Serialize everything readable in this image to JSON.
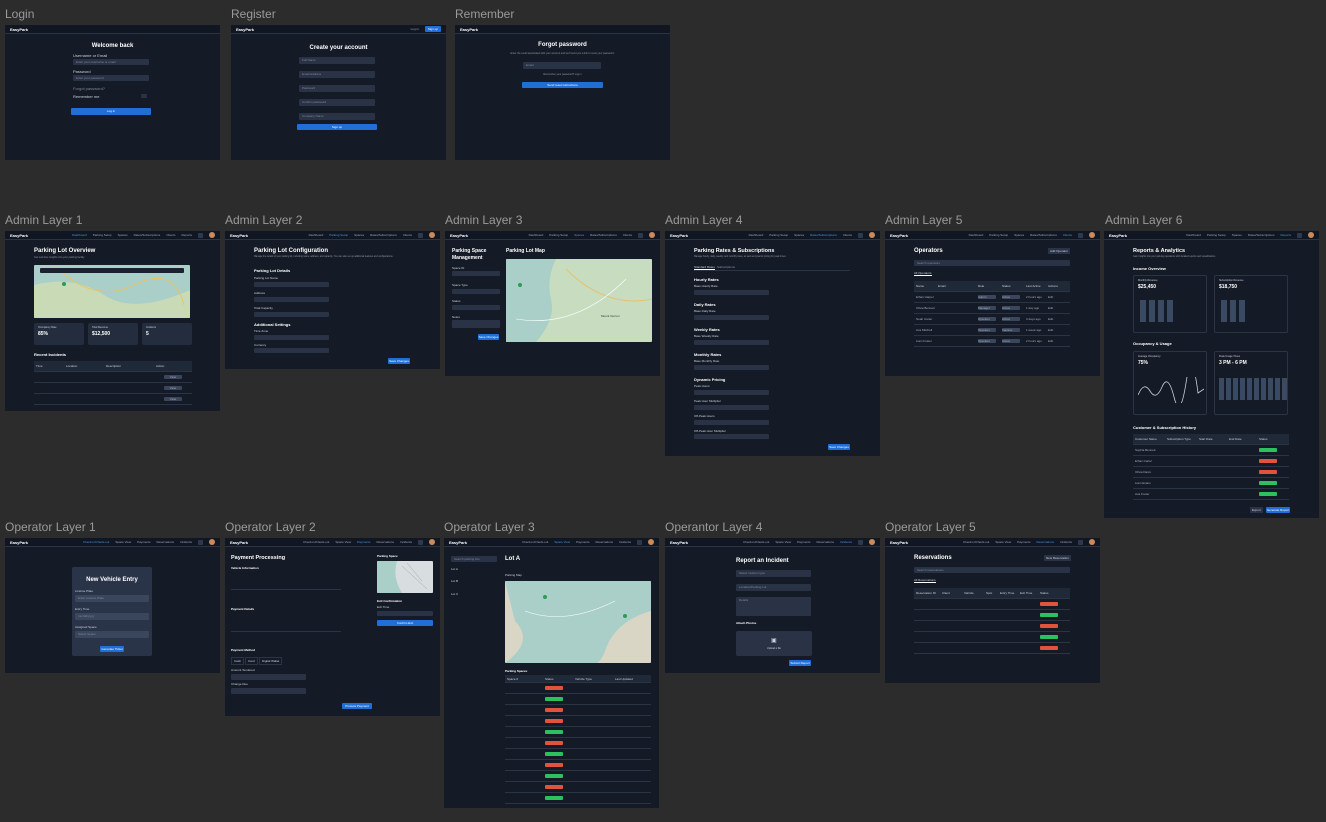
{
  "brand": "EasyPark",
  "labels": {
    "login": "Login",
    "register": "Register",
    "remember": "Remember",
    "admin1": "Admin Layer 1",
    "admin2": "Admin Layer 2",
    "admin3": "Admin Layer 3",
    "admin4": "Admin Layer 4",
    "admin5": "Admin Layer 5",
    "admin6": "Admin Layer 6",
    "op1": "Operator Layer 1",
    "op2": "Operator Layer 2",
    "op3": "Operator Layer 3",
    "op4": "Operantor Layer 4",
    "op5": "Operator Layer 5"
  },
  "login": {
    "title": "Welcome back",
    "user_label": "Username or Email",
    "user_ph": "Enter your username or email",
    "pass_label": "Password",
    "pass_ph": "Enter your password",
    "forgot": "Forgot password?",
    "remember": "Remember me",
    "button": "Log in"
  },
  "register": {
    "nav_login": "Log in",
    "nav_signup": "Sign up",
    "title": "Create your account",
    "fields": [
      "Full Name",
      "Email Address",
      "Password",
      "Confirm password",
      "Company Name"
    ],
    "button": "Sign up"
  },
  "remember": {
    "title": "Forgot password",
    "subtitle": "Enter the email associated with your account and we'll send you a link to reset your password.",
    "email_ph": "Email",
    "remembered": "Remember your password? Log in",
    "button": "Send reset instructions"
  },
  "admin_nav": [
    "Dashboard",
    "Parking Setup",
    "Spaces",
    "Rates/Subscriptions",
    "Clients",
    "Reports"
  ],
  "admin1": {
    "title": "Parking Lot Overview",
    "subtitle": "Get real-time insights into your parking facility",
    "stats": [
      {
        "label": "Occupancy Rate",
        "value": "85%"
      },
      {
        "label": "Total Revenue",
        "value": "$12,500"
      },
      {
        "label": "Incidents",
        "value": "5"
      }
    ],
    "incidents_title": "Recent Incidents",
    "cols": [
      "Time",
      "Location",
      "Description",
      "Action"
    ],
    "action": "View"
  },
  "admin2": {
    "title": "Parking Lot Configuration",
    "subtitle": "Manage the details of your parking lot, including name, address, and capacity. You can also set up additional features and configurations.",
    "section1": "Parking Lot Details",
    "f1": "Parking Lot Name",
    "f2": "Address",
    "f3": "Total Capacity",
    "section2": "Additional Settings",
    "f4": "Time Zone",
    "f5": "Currency",
    "button": "Save Changes"
  },
  "admin3": {
    "title1": "Parking Space",
    "title2": "Management",
    "map_title": "Parking Lot Map",
    "f1": "Space ID",
    "f2": "Space Type",
    "f3": "Status",
    "f4": "Notes",
    "button": "Save Changes",
    "map_city": "Mount Vernon"
  },
  "admin4": {
    "title": "Parking Rates & Subscriptions",
    "subtitle": "Manage hourly, daily, weekly, and monthly rates, as well as dynamic pricing for peak times.",
    "tabs": [
      "Standard Rates",
      "Subscriptions"
    ],
    "sections": [
      {
        "h": "Hourly Rates",
        "f": "Base Hourly Rate"
      },
      {
        "h": "Daily Rates",
        "f": "Base Daily Rate"
      },
      {
        "h": "Weekly Rates",
        "f": "Base Weekly Rate"
      },
      {
        "h": "Monthly Rates",
        "f": "Base Monthly Rate"
      },
      {
        "h": "Dynamic Pricing",
        "f": "Peak Hours"
      }
    ],
    "extra": [
      "Peak Hour Multiplier",
      "Off-Peak Hours",
      "Off-Peak Hour Multiplier"
    ],
    "button": "Save Changes"
  },
  "admin5": {
    "title": "Operators",
    "add": "Add Operator",
    "search_ph": "Search operators",
    "tab": "All Operators",
    "cols": [
      "Name",
      "Email",
      "Role",
      "Status",
      "Last Active",
      "Actions"
    ],
    "rows": [
      {
        "name": "Ethan Harper",
        "role": "Admin",
        "status": "Active",
        "last": "2 hours ago"
      },
      {
        "name": "Olivia Bennett",
        "role": "Manager",
        "status": "Active",
        "last": "1 day ago"
      },
      {
        "name": "Noah Carter",
        "role": "Operator",
        "status": "Active",
        "last": "3 days ago"
      },
      {
        "name": "Ava Mitchell",
        "role": "Operator",
        "status": "Inactive",
        "last": "1 week ago"
      },
      {
        "name": "Liam Foster",
        "role": "Operator",
        "status": "Active",
        "last": "2 hours ago"
      }
    ],
    "action": "Edit"
  },
  "admin6": {
    "title": "Reports & Analytics",
    "subtitle": "Gain insights into your parking operations with detailed reports and visualizations.",
    "income": "Income Overview",
    "c1_label": "Monthly Revenue",
    "c1_value": "$25,450",
    "c2_label": "Subscription Revenue",
    "c2_value": "$18,750",
    "occ": "Occupancy & Usage",
    "c3_label": "Average Occupancy",
    "c3_value": "75%",
    "c4_label": "Peak Usage Times",
    "c4_value": "3 PM - 6 PM",
    "history": "Customer & Subscription History",
    "hist_cols": [
      "Customer Name",
      "Subscription Type",
      "Start Date",
      "End Date",
      "Status"
    ],
    "hist_rows": [
      "Sophia Bennett",
      "Ethan Carter",
      "Olivia Davis",
      "Liam Evans",
      "Ava Foster"
    ],
    "export": "Export",
    "generate": "Generate Report"
  },
  "op_nav": [
    "Check-in/Check-out",
    "Space View",
    "Payments",
    "Reservations",
    "Incidents"
  ],
  "op1": {
    "title": "New Vehicle Entry",
    "f1": "License Plate",
    "f1_ph": "Enter License Plate",
    "f2": "Entry Time",
    "f2_ph": "mm/dd/yyyy",
    "f3": "Assigned Space",
    "f3_ph": "Select Space",
    "button": "Generate Ticket"
  },
  "op2": {
    "title": "Payment Processing",
    "vinfo": "Vehicle Information",
    "pdetails": "Payment Details",
    "pmethod": "Payment Method",
    "methods": [
      "Cash",
      "Card",
      "Digital Wallet"
    ],
    "amount": "Amount Tendered",
    "change": "Change Due",
    "space": "Parking Space",
    "exit": "Exit Confirmation",
    "exit_time": "Exit Time",
    "confirm": "Confirm Exit",
    "button": "Process Payment"
  },
  "op3": {
    "search_ph": "Search parking lots",
    "lots": [
      "Lot A",
      "Lot B",
      "Lot C"
    ],
    "title": "Lot A",
    "sub": "Parking Map",
    "spaces": "Parking Spaces",
    "cols": [
      "Space #",
      "Status",
      "Vehicle Type",
      "Last Updated"
    ]
  },
  "op4": {
    "title": "Report an Incident",
    "type_ph": "Select incident type",
    "loc_ph": "Location/Parking Lot",
    "details_ph": "Details",
    "attach": "Attach Photos",
    "upload": "Upload a file",
    "button": "Submit Report"
  },
  "op5": {
    "title": "Reservations",
    "new": "New Reservation",
    "search_ph": "Search reservations",
    "tab": "All Reservations",
    "cols": [
      "Reservation ID",
      "Client",
      "Vehicle",
      "Spot",
      "Entry Time",
      "Exit Time",
      "Status"
    ]
  }
}
